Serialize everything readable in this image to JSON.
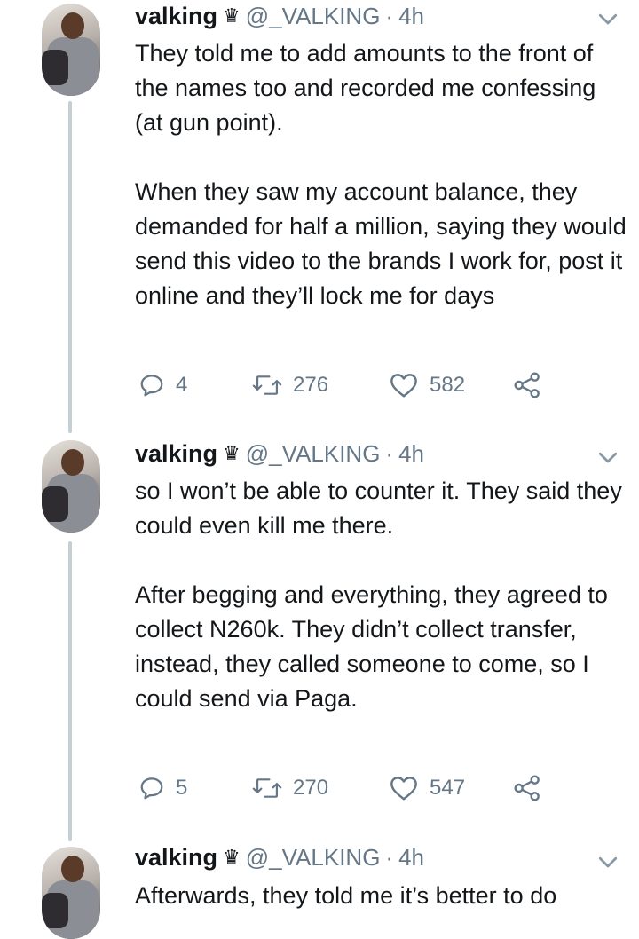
{
  "tweets": [
    {
      "name": "valking",
      "crown_glyph": "♛",
      "handle": "@_VALKING",
      "separator": "·",
      "time": "4h",
      "text": "They told me to add amounts to the front of the names too and recorded me confessing (at gun point).\n\nWhen they saw my account balance, they demanded for half a million, saying they would send this video to the brands I work for, post it online and they’ll lock me for days",
      "replies": "4",
      "retweets": "276",
      "likes": "582"
    },
    {
      "name": "valking",
      "crown_glyph": "♛",
      "handle": "@_VALKING",
      "separator": "·",
      "time": "4h",
      "text": "so I won’t be able to counter it. They said they could even kill me there.\n\nAfter begging and everything, they agreed to collect N260k. They didn’t collect transfer, instead, they called someone to come, so I could send via Paga.",
      "replies": "5",
      "retweets": "270",
      "likes": "547"
    },
    {
      "name": "valking",
      "crown_glyph": "♛",
      "handle": "@_VALKING",
      "separator": "·",
      "time": "4h",
      "text": "Afterwards, they told me it’s better to do"
    }
  ],
  "icons": {
    "reply": "reply-icon",
    "retweet": "retweet-icon",
    "like": "heart-icon",
    "share": "share-icon",
    "menu": "chevron-down-icon",
    "verified_crown": "crown-icon"
  },
  "colors": {
    "text": "#14171a",
    "secondary": "#657786",
    "thread_line": "#c4cfd6",
    "background": "#ffffff"
  }
}
